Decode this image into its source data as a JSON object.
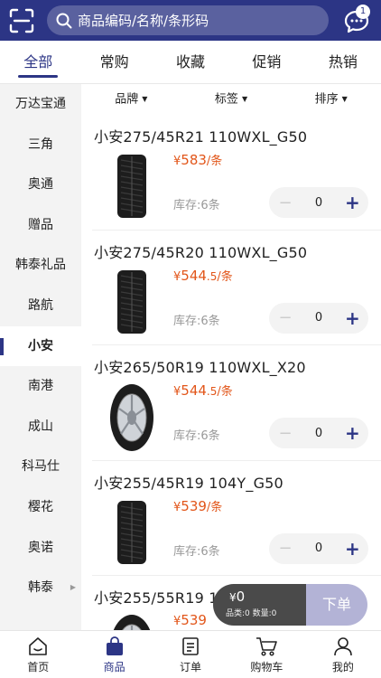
{
  "search": {
    "placeholder": "商品编码/名称/条形码"
  },
  "message": {
    "badge": "1"
  },
  "tabs": [
    {
      "label": "全部"
    },
    {
      "label": "常购"
    },
    {
      "label": "收藏"
    },
    {
      "label": "促销"
    },
    {
      "label": "热销"
    }
  ],
  "categories": [
    {
      "label": "万达宝通"
    },
    {
      "label": "三角"
    },
    {
      "label": "奥通"
    },
    {
      "label": "赠品"
    },
    {
      "label": "韩泰礼品"
    },
    {
      "label": "路航"
    },
    {
      "label": "小安"
    },
    {
      "label": "南港"
    },
    {
      "label": "成山"
    },
    {
      "label": "科马仕"
    },
    {
      "label": "樱花"
    },
    {
      "label": "奥诺"
    },
    {
      "label": "韩泰"
    }
  ],
  "filters": [
    {
      "label": "品牌"
    },
    {
      "label": "标签"
    },
    {
      "label": "排序"
    }
  ],
  "products": [
    {
      "name": "小安275/45R21 110WXL_G50",
      "currency": "¥",
      "price_int": "583",
      "price_dec": "",
      "unit": "/条",
      "stock": "库存:6条",
      "qty": "0"
    },
    {
      "name": "小安275/45R20 110WXL_G50",
      "currency": "¥",
      "price_int": "544",
      "price_dec": ".5",
      "unit": "/条",
      "stock": "库存:6条",
      "qty": "0"
    },
    {
      "name": "小安265/50R19 110WXL_X20",
      "currency": "¥",
      "price_int": "544",
      "price_dec": ".5",
      "unit": "/条",
      "stock": "库存:6条",
      "qty": "0"
    },
    {
      "name": "小安255/45R19 104Y_G50",
      "currency": "¥",
      "price_int": "539",
      "price_dec": "",
      "unit": "/条",
      "stock": "库存:6条",
      "qty": "0"
    },
    {
      "name": "小安255/55R19 1",
      "currency": "¥",
      "price_int": "539",
      "price_dec": "",
      "unit": "",
      "stock": "",
      "qty": ""
    }
  ],
  "cart": {
    "currency": "¥",
    "amount": "0",
    "meta": "品类:0 数量:0",
    "order_label": "下单"
  },
  "bottom_nav": [
    {
      "label": "首页",
      "icon": "home-icon"
    },
    {
      "label": "商品",
      "icon": "bag-icon"
    },
    {
      "label": "订单",
      "icon": "order-icon"
    },
    {
      "label": "购物车",
      "icon": "cart-icon"
    },
    {
      "label": "我的",
      "icon": "user-icon"
    }
  ],
  "colors": {
    "brand": "#2c3585",
    "price": "#e2561a",
    "order_button": "#b3b3d6"
  }
}
